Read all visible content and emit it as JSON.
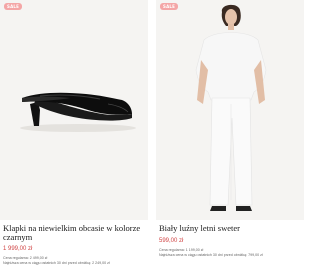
{
  "products": [
    {
      "badge": "SALE",
      "title": "Klapki na niewielkim obcasie w kolorze czarnym",
      "price": "1 999,00 zł",
      "regular": "Cena regularna: 2 499,00 zł",
      "lowest": "Najniższa cena w ciągu ostatnich 30 dni przed obniżką: 2 249,00 zł",
      "image_icon": "black-heeled-mule-shoe-image"
    },
    {
      "badge": "SALE",
      "title": "Biały luźny letni sweter",
      "price": "599,00 zł",
      "regular": "Cena regularna: 1 199,00 zł",
      "lowest": "Najniższa cena w ciągu ostatnich 30 dni przed obniżką: 799,00 zł",
      "image_icon": "model-in-white-outfit-image"
    }
  ],
  "colors": {
    "badge": "#f4a6a6",
    "price": "#d04343"
  }
}
